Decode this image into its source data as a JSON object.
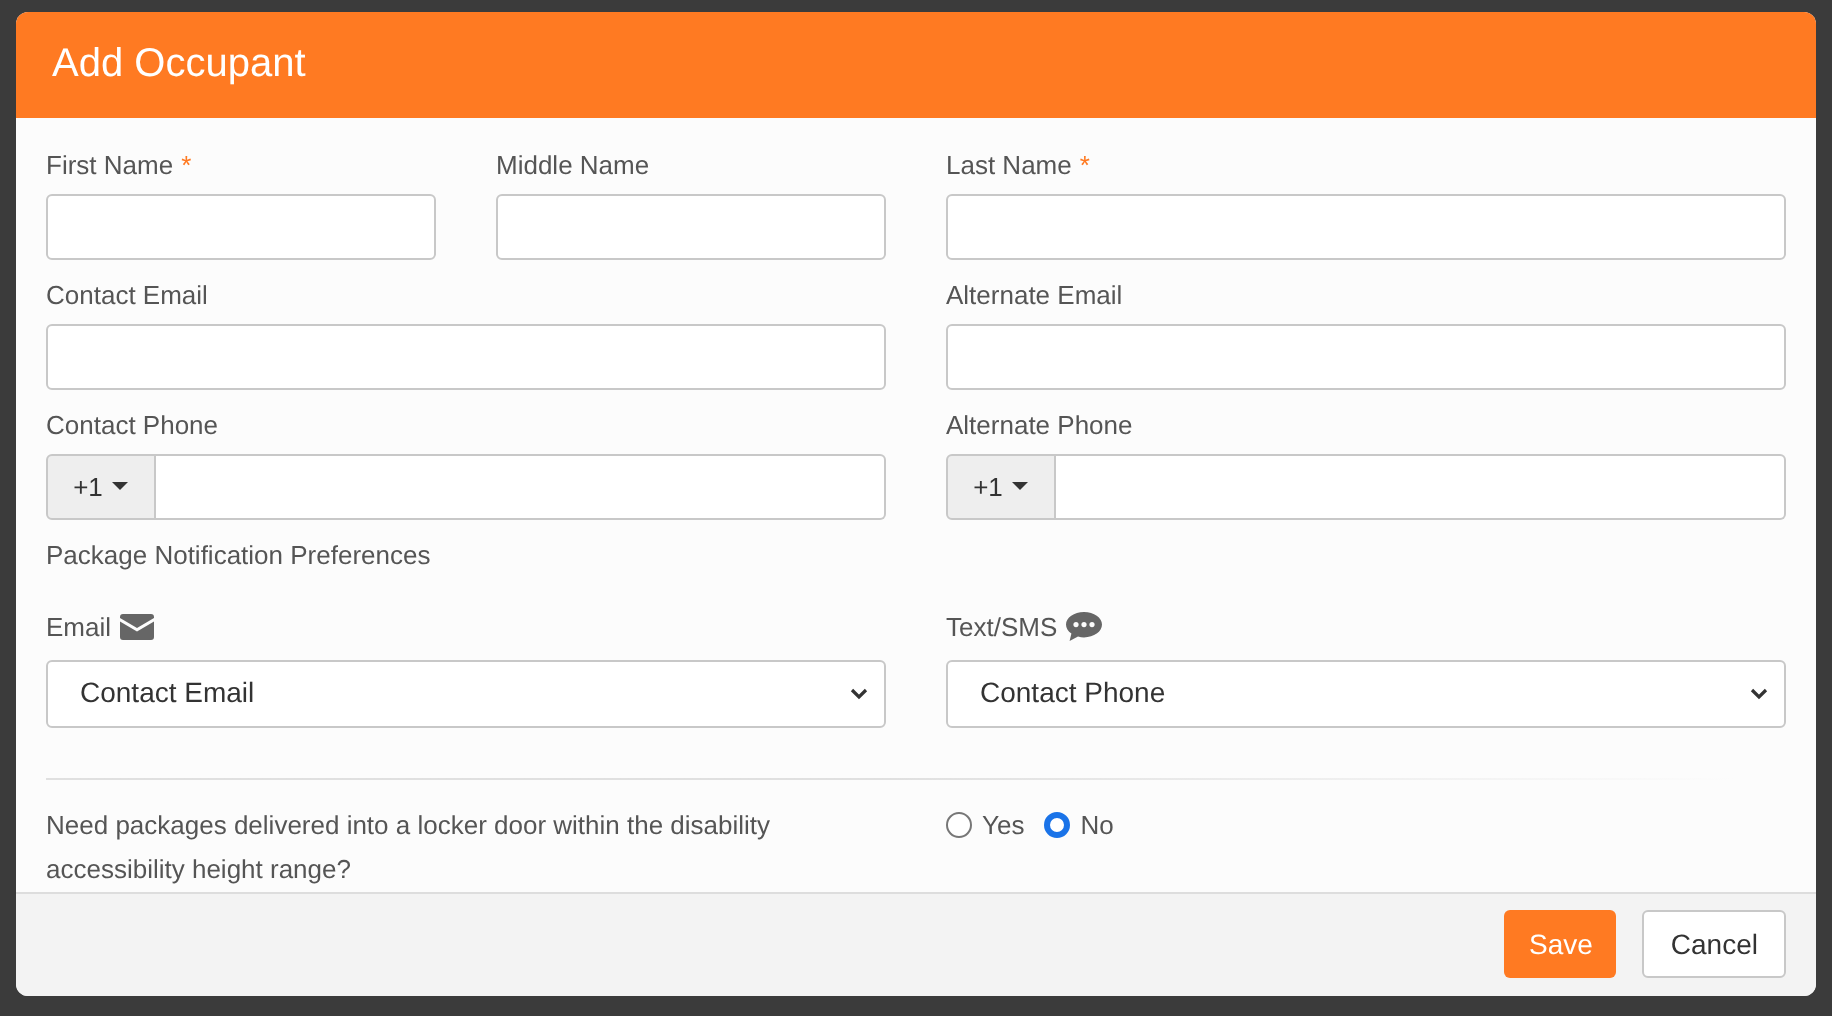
{
  "dialog": {
    "title": "Add Occupant"
  },
  "required_marker": "*",
  "name_fields": [
    {
      "label": "First Name",
      "required": true
    },
    {
      "label": "Middle Name",
      "required": false
    },
    {
      "label": "Last Name",
      "required": true
    }
  ],
  "email_fields": [
    {
      "label": "Contact Email"
    },
    {
      "label": "Alternate Email"
    }
  ],
  "phone_fields": [
    {
      "label": "Contact Phone",
      "country_code": "+1"
    },
    {
      "label": "Alternate Phone",
      "country_code": "+1"
    }
  ],
  "section_heading": "Package Notification Preferences",
  "notification_selects": [
    {
      "label": "Email",
      "kind": "email",
      "value": "Contact Email"
    },
    {
      "label": "Text/SMS",
      "kind": "sms",
      "value": "Contact Phone"
    }
  ],
  "question": {
    "text": "Need packages delivered into a locker door within the disability accessibility height range?",
    "options": [
      {
        "label": "Yes",
        "selected": false
      },
      {
        "label": "No",
        "selected": true
      }
    ]
  },
  "buttons": [
    {
      "label": "Save",
      "kind": "primary"
    },
    {
      "label": "Cancel",
      "kind": "secondary"
    }
  ]
}
